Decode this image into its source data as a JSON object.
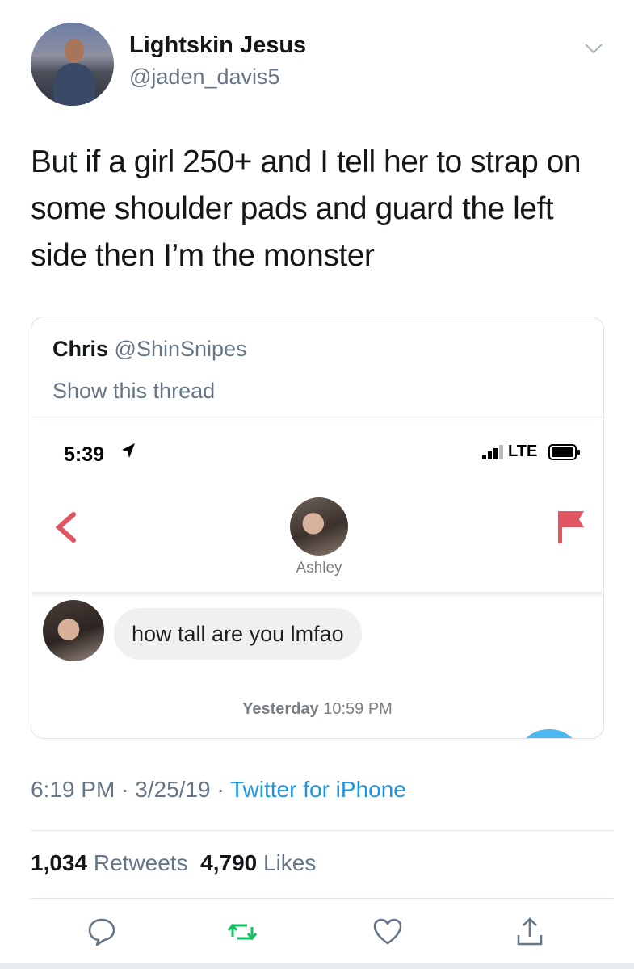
{
  "tweet": {
    "display_name": "Lightskin Jesus",
    "handle": "@jaden_davis5",
    "text": "But if a girl 250+ and I tell her to strap on some shoulder pads and guard the left side then I’m the monster",
    "time": "6:19 PM",
    "date": "3/25/19",
    "source": "Twitter for iPhone",
    "separator": "·",
    "retweets_count": "1,034",
    "retweets_label": "Retweets",
    "likes_count": "4,790",
    "likes_label": "Likes"
  },
  "quoted": {
    "name": "Chris",
    "handle": "@ShinSnipes",
    "show_thread": "Show this thread",
    "screenshot": {
      "status_time": "5:39",
      "carrier": "LTE",
      "contact_name": "Ashley",
      "message": "how tall are you lmfao",
      "stamp_day": "Yesterday",
      "stamp_time": "10:59 PM"
    }
  },
  "colors": {
    "link_blue": "#1b95e0",
    "secondary_text": "#657786",
    "retweet_green": "#17bf63",
    "flag_red": "#e0555f"
  },
  "icons": {
    "menu": "chevron-down-icon",
    "reply": "reply-icon",
    "retweet": "retweet-icon",
    "like": "heart-icon",
    "share": "share-icon"
  }
}
